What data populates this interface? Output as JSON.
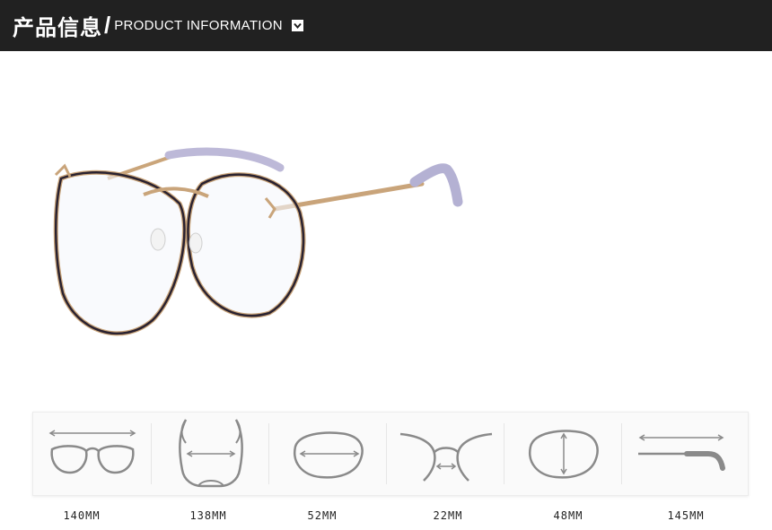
{
  "header": {
    "title_cn": "产品信息",
    "slash": "/",
    "title_en": "PRODUCT INFORMATION",
    "icon": "chevron-down-icon",
    "background": "#212121"
  },
  "product_image": {
    "icon": "eyeglasses-icon",
    "frame_color": "#2a2230",
    "rim_color": "#c9a47a",
    "temple_tip_color": "#b9b6d6"
  },
  "measurements": [
    {
      "icon": "frame-width-icon",
      "value": "140MM"
    },
    {
      "icon": "temple-to-temple-icon",
      "value": "138MM"
    },
    {
      "icon": "lens-width-icon",
      "value": "52MM"
    },
    {
      "icon": "bridge-width-icon",
      "value": "22MM"
    },
    {
      "icon": "lens-height-icon",
      "value": "48MM"
    },
    {
      "icon": "temple-length-icon",
      "value": "145MM"
    }
  ]
}
